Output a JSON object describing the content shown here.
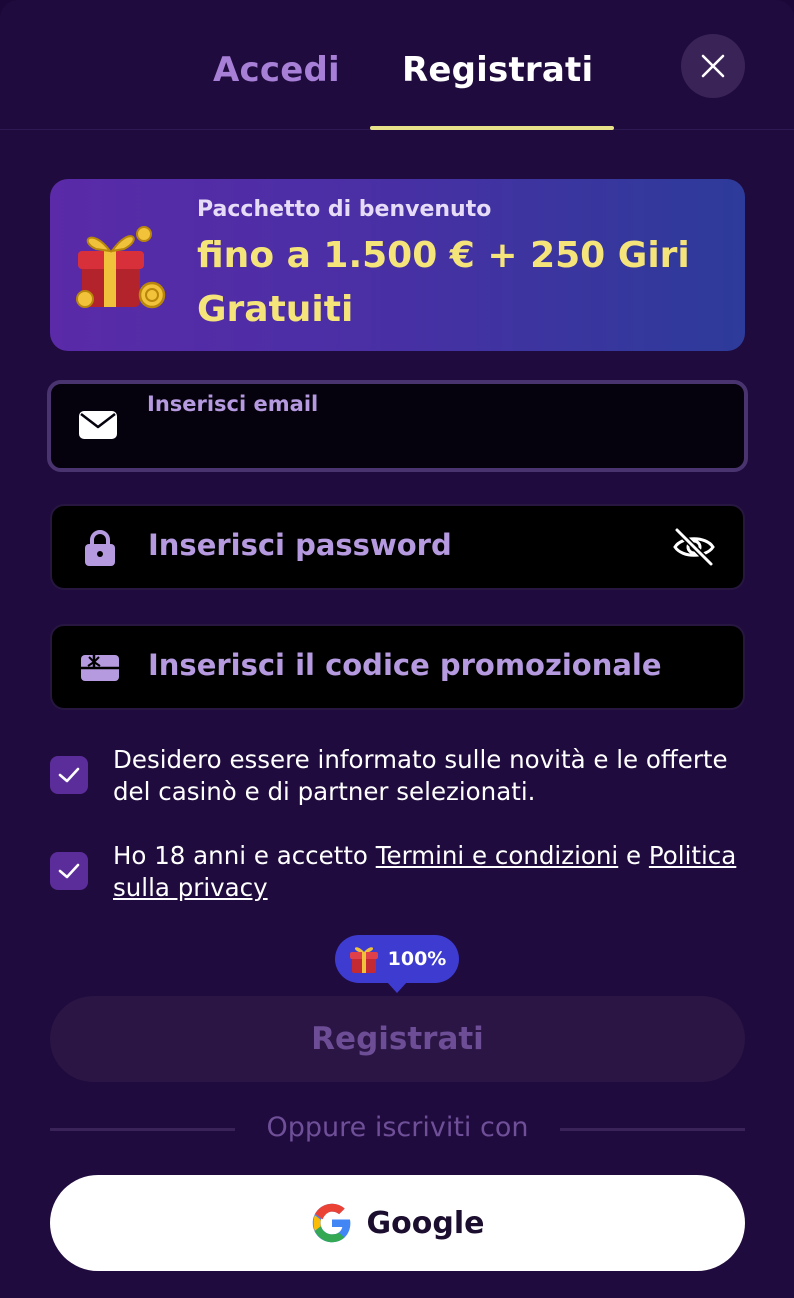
{
  "tabs": {
    "login": "Accedi",
    "register": "Registrati"
  },
  "promo": {
    "subtitle": "Pacchetto di benvenuto",
    "title": "fino a 1.500 € + 250 Giri Gratuiti"
  },
  "fields": {
    "email_placeholder": "Inserisci email",
    "password_placeholder": "Inserisci password",
    "promo_placeholder": "Inserisci il codice promozionale"
  },
  "checks": {
    "newsletter": "Desidero essere informato sulle novità e le offerte del casinò e di partner selezionati.",
    "newsletter_checked": true,
    "terms_prefix": "Ho 18 anni e accetto ",
    "terms_link": "Termini e condizioni",
    "terms_mid": " e ",
    "privacy_link": "Politica sulla privacy",
    "terms_checked": true
  },
  "bonus": {
    "label": "100%"
  },
  "submit_label": "Registrati",
  "divider_text": "Oppure iscriviti con",
  "google_label": "Google",
  "icons": {
    "close": "close-icon",
    "gift": "gift-icon",
    "mail": "mail-icon",
    "lock": "lock-icon",
    "eye_off": "eye-off-icon",
    "promo": "ticket-icon",
    "check": "check-icon",
    "google": "google-logo-icon"
  },
  "colors": {
    "background": "#1f0b3d",
    "accent_yellow": "#f4e47a",
    "checkbox": "#5b2d9a",
    "bonus": "#3e3bd1",
    "placeholder": "#b69ae0"
  }
}
